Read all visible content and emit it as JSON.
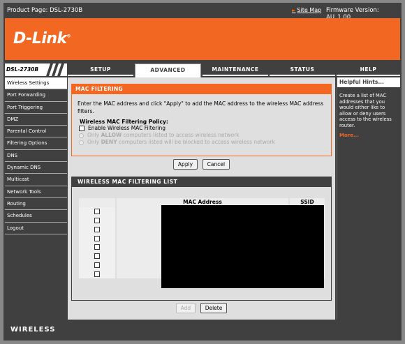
{
  "topbar": {
    "product": "Product Page: DSL-2730B",
    "site_map": "Site Map",
    "firmware": "Firmware Version: AU_1.00"
  },
  "brand": {
    "logo": "D-Link",
    "accent": "#f26722"
  },
  "model_label": "DSL-2730B",
  "tabs": [
    {
      "label": "SETUP",
      "active": false
    },
    {
      "label": "ADVANCED",
      "active": true
    },
    {
      "label": "MAINTENANCE",
      "active": false
    },
    {
      "label": "STATUS",
      "active": false
    },
    {
      "label": "HELP",
      "active": false
    }
  ],
  "sidebar": [
    {
      "label": "Wireless Settings",
      "active": true
    },
    {
      "label": "Port Forwarding"
    },
    {
      "label": "Port Triggering"
    },
    {
      "label": "DMZ"
    },
    {
      "label": "Parental Control"
    },
    {
      "label": "Filtering Options"
    },
    {
      "label": "DNS"
    },
    {
      "label": "Dynamic DNS"
    },
    {
      "label": "Multicast"
    },
    {
      "label": "Network Tools"
    },
    {
      "label": "Routing"
    },
    {
      "label": "Schedules"
    },
    {
      "label": "Logout"
    }
  ],
  "mac_filtering": {
    "title": "MAC FILTERING",
    "description": "Enter the MAC address and click \"Apply\" to add the MAC address to the wireless MAC address filters.",
    "policy_title": "Wireless MAC Filtering Policy:",
    "enable_label": "Enable Wireless MAC Filtering",
    "allow_prefix": "Only ",
    "allow_word": "ALLOW",
    "allow_suffix": " computers listed to access wireless network",
    "deny_prefix": "Only ",
    "deny_word": "DENY",
    "deny_suffix": " computers listed will be blocked to access wireless network",
    "apply_label": "Apply",
    "cancel_label": "Cancel"
  },
  "list": {
    "title": "WIRELESS MAC FILTERING LIST",
    "col_mac": "MAC Address",
    "col_ssid": "SSID",
    "row_count": 8,
    "add_label": "Add",
    "delete_label": "Delete"
  },
  "help": {
    "title": "Helpful Hints...",
    "text": "Create a list of MAC addresses that you would either like to allow or deny users access to the wireless router.",
    "more": "More..."
  },
  "footer": "WIRELESS"
}
